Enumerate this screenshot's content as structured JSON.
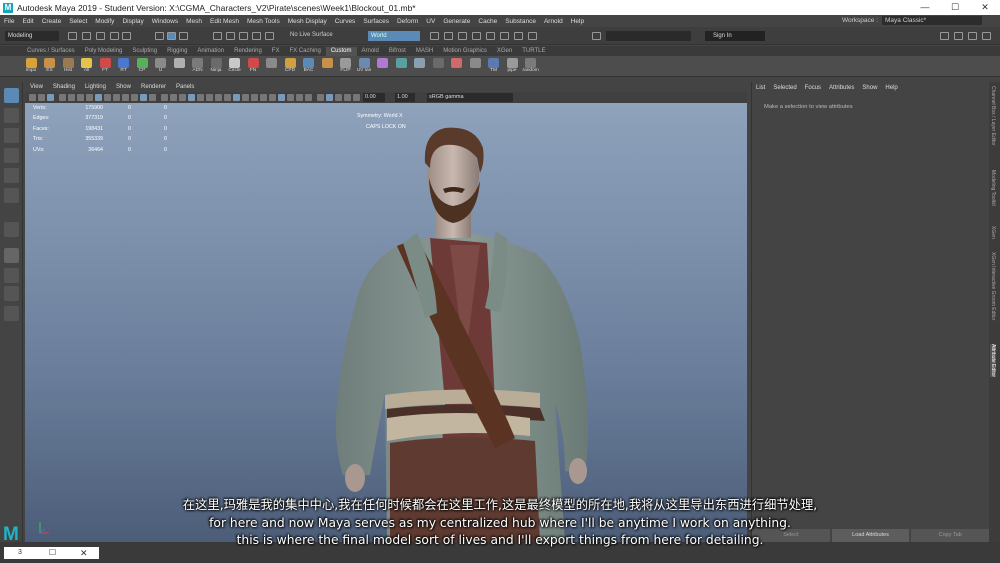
{
  "titlebar": {
    "title": "Autodesk Maya 2019 - Student Version: X:\\CGMA_Characters_V2\\Pirate\\scenes\\Week1\\Blockout_01.mb*",
    "app_icon": "M",
    "min": "—",
    "max": "☐",
    "close": "✕"
  },
  "menubar": [
    "File",
    "Edit",
    "Create",
    "Select",
    "Modify",
    "Display",
    "Windows",
    "Mesh",
    "Edit Mesh",
    "Mesh Tools",
    "Mesh Display",
    "Curves",
    "Surfaces",
    "Deform",
    "UV",
    "Generate",
    "Cache",
    "Substance",
    "Arnold",
    "Help"
  ],
  "workspace": {
    "label": "Workspace :",
    "value": "Maya Classic*"
  },
  "status": {
    "mode": "Modeling",
    "live_surface": "No Live Surface",
    "world": "World",
    "signin": "Sign In"
  },
  "shelf_tabs": [
    "Curves / Surfaces",
    "Poly Modeling",
    "Sculpting",
    "Rigging",
    "Animation",
    "Rendering",
    "FX",
    "FX Caching",
    "Custom",
    "Arnold",
    "Bifrost",
    "MASH",
    "Motion Graphics",
    "XGen",
    "TURTLE"
  ],
  "shelf_active": "Custom",
  "shelf_buttons": [
    "Impo",
    "ES",
    "Hist",
    "All",
    "FT",
    "RT",
    "CP",
    "U",
    "",
    "ADN",
    "Ninja",
    "Circle",
    "FN",
    "",
    "CPD",
    "BAC",
    "",
    "FLIP",
    "UV tan",
    "",
    "",
    "",
    "",
    "",
    "",
    "TM",
    "pipe",
    "random"
  ],
  "panel_menu": [
    "View",
    "Shading",
    "Lighting",
    "Show",
    "Renderer",
    "Panels"
  ],
  "panel_fields": {
    "near": "0.00",
    "far": "1.00",
    "colorspace": "sRGB gamma"
  },
  "hud": {
    "rows": [
      {
        "k": "Verts:",
        "a": "175900",
        "b": "0",
        "c": "0"
      },
      {
        "k": "Edges:",
        "a": "377319",
        "b": "0",
        "c": "0"
      },
      {
        "k": "Faces:",
        "a": "198431",
        "b": "0",
        "c": "0"
      },
      {
        "k": "Tris:",
        "a": "355339",
        "b": "0",
        "c": "0"
      },
      {
        "k": "UVs:",
        "a": "36464",
        "b": "0",
        "c": "0"
      }
    ],
    "symmetry": "Symmetry: World X",
    "caps": "CAPS LOCK ON"
  },
  "attribute_editor": {
    "menu": [
      "List",
      "Selected",
      "Focus",
      "Attributes",
      "Show",
      "Help"
    ],
    "message": "Make a selection to view attributes",
    "buttons": [
      "Select",
      "Load Attributes",
      "Copy Tab"
    ]
  },
  "side_tabs": [
    "Channel Box / Layer Editor",
    "Modeling Toolkit",
    "XGen",
    "XGen Interactive Groom Editor",
    "Attribute Editor"
  ],
  "side_tab_active": "Attribute Editor",
  "cmdline": {
    "label": "3",
    "square": "☐",
    "close": "✕"
  },
  "logo": "M",
  "subtitles": [
    "在这里,玛雅是我的集中中心,我在任何时候都会在这里工作,这是最终模型的所在地,我将从这里导出东西进行细节处理,",
    "for here and now Maya serves as my centralized hub where I'll be anytime I work on anything.",
    "this is where the final model sort of lives and I'll export things from here for detailing."
  ],
  "colors": {
    "viewport_top": "#8fa2bc",
    "viewport_bottom": "#4c5d78",
    "accent": "#1fb4c6",
    "world_field": "#5a8ab5"
  }
}
